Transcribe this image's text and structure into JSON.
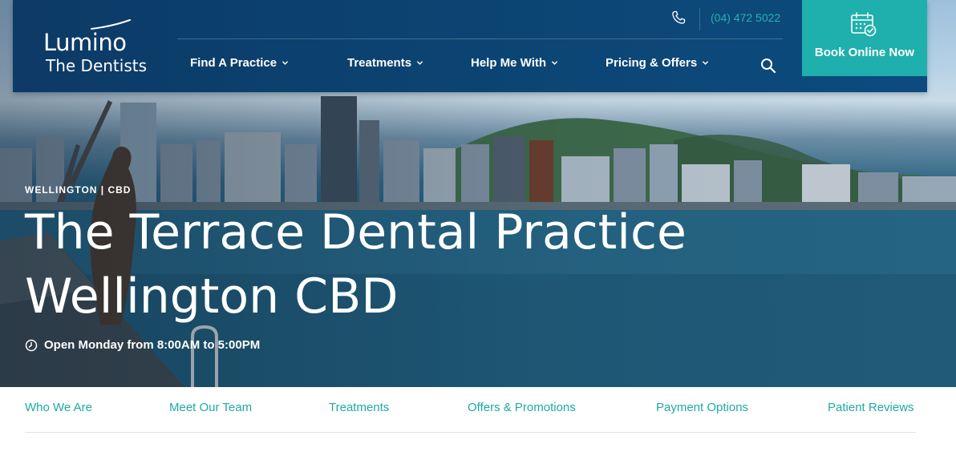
{
  "brand": {
    "name_line1": "Lumino",
    "name_line2": "The Dentists"
  },
  "contact": {
    "phone_icon": "phone-icon",
    "phone": "(04) 472 5022"
  },
  "nav": {
    "items": [
      {
        "label": "Find A Practice"
      },
      {
        "label": "Treatments"
      },
      {
        "label": "Help Me With"
      },
      {
        "label": "Pricing & Offers"
      }
    ],
    "search_icon": "search-icon"
  },
  "cta": {
    "label": "Book Online Now",
    "icon": "calendar-check-icon"
  },
  "hero": {
    "eyebrow": "WELLINGTON | CBD",
    "title_line1": "The Terrace Dental Practice",
    "title_line2": "Wellington CBD",
    "hours": "Open Monday from 8:00AM to 5:00PM",
    "hours_icon": "clock-icon"
  },
  "subnav": {
    "items": [
      {
        "label": "Who We Are"
      },
      {
        "label": "Meet Our Team"
      },
      {
        "label": "Treatments"
      },
      {
        "label": "Offers & Promotions"
      },
      {
        "label": "Payment Options"
      },
      {
        "label": "Patient Reviews"
      }
    ]
  },
  "colors": {
    "header_bg": "#0d4274",
    "accent_teal": "#1fb0ad",
    "subnav_text": "#1fa9a6",
    "white": "#ffffff"
  }
}
